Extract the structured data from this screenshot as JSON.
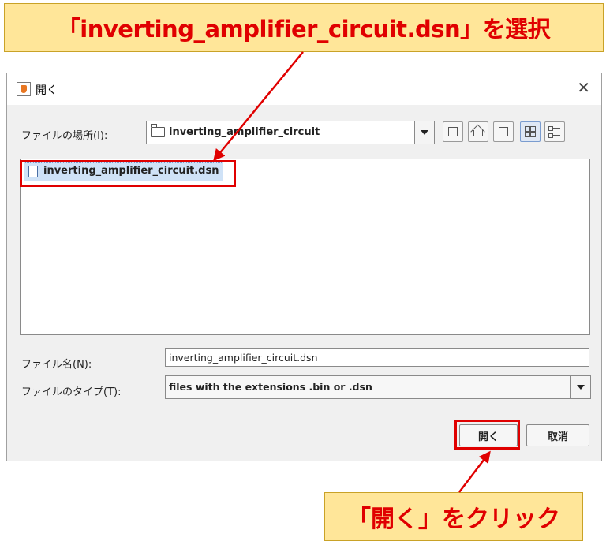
{
  "annotations": {
    "select_instruction": "「inverting_amplifier_circuit.dsn」を選択",
    "click_instruction": "「開く」をクリック"
  },
  "dialog": {
    "title": "開く",
    "close_icon": "close-icon",
    "look_in_label": "ファイルの場所(I):",
    "look_in_value": "inverting_amplifier_circuit",
    "toolbar": [
      "up-folder-icon",
      "home-icon",
      "new-folder-icon",
      "list-view-icon",
      "details-view-icon"
    ],
    "files": [
      {
        "name": "inverting_amplifier_circuit.dsn",
        "icon": "file-icon",
        "selected": true
      }
    ],
    "file_name_label": "ファイル名(N):",
    "file_name_value": "inverting_amplifier_circuit.dsn",
    "file_type_label": "ファイルのタイプ(T):",
    "file_type_value": "files with the extensions .bin or  .dsn",
    "open_button": "開く",
    "cancel_button": "取消"
  },
  "colors": {
    "callout_bg": "#ffe699",
    "callout_text": "#e00000",
    "highlight": "#e00000",
    "selection_bg": "#cfe2f7"
  }
}
